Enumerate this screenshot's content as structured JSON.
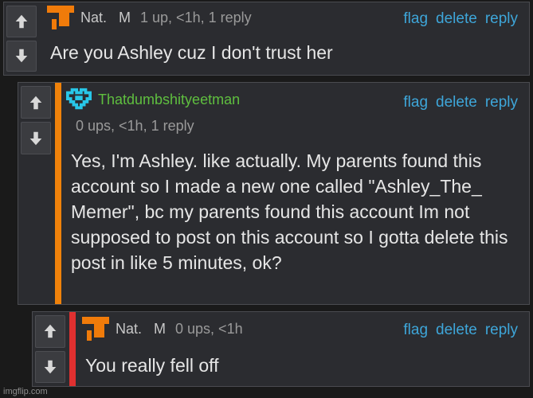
{
  "comments": [
    {
      "username": "Nat.   M",
      "meta": "1 up, <1h, 1 reply",
      "text": "Are you Ashley cuz I don't trust her",
      "actions": {
        "flag": "flag",
        "delete": "delete",
        "reply": "reply"
      }
    },
    {
      "username": "Thatdumbshityeetman",
      "meta": "0 ups, <1h, 1 reply",
      "text": "Yes, I'm Ashley. like actually. My parents found this account so I made a new one called \"Ashley_The_ Memer\", bc my parents found this account Im not supposed to post on this account so I gotta delete this post in like 5 minutes, ok?",
      "actions": {
        "flag": "flag",
        "delete": "delete",
        "reply": "reply"
      }
    },
    {
      "username": "Nat.   M",
      "meta": "0 ups, <1h",
      "text": "You really fell off",
      "actions": {
        "flag": "flag",
        "delete": "delete",
        "reply": "reply"
      }
    }
  ],
  "watermark": "imgflip.com",
  "colors": {
    "stripe_orange": "#f0820a",
    "stripe_red": "#e03030",
    "link": "#3ea6d9",
    "green_user": "#5fbf3f",
    "heart_cyan": "#28c7e8"
  }
}
